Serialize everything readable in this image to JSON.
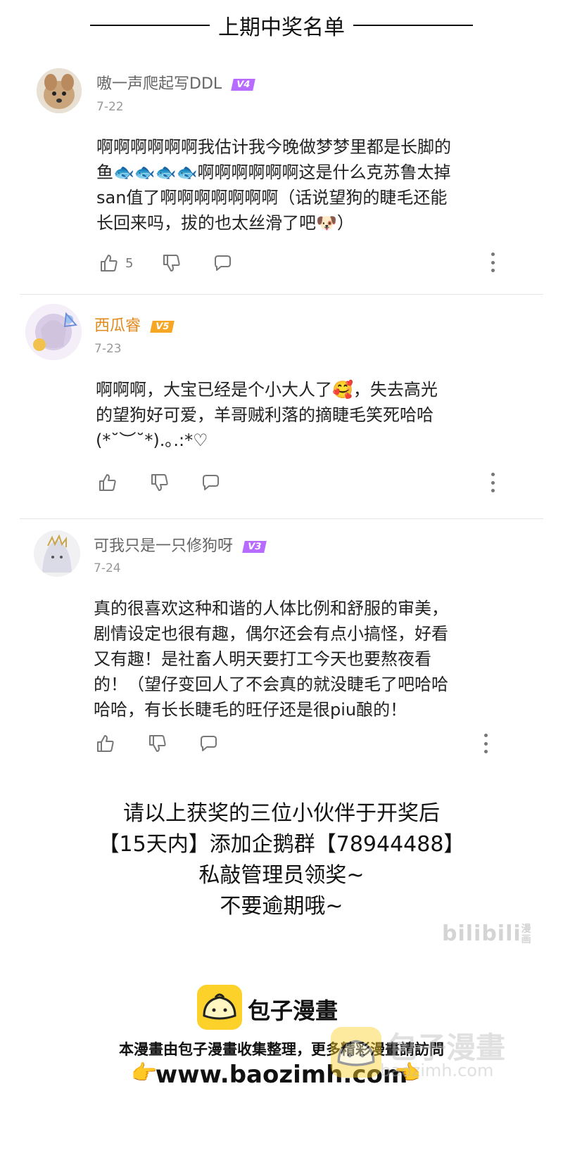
{
  "header": {
    "title": "上期中奖名单"
  },
  "comments": [
    {
      "username": "嗷一声爬起写DDL",
      "level": "V4",
      "date": "7-22",
      "text": "啊啊啊啊啊啊我估计我今晚做梦梦里都是长脚的\n鱼🐟🐟🐟🐟啊啊啊啊啊啊这是什么克苏鲁太掉\nsan值了啊啊啊啊啊啊啊（话说望狗的睫毛还能\n长回来吗，拔的也太丝滑了吧🐶）",
      "likes": "5"
    },
    {
      "username": "西瓜睿",
      "level": "V5",
      "date": "7-23",
      "text": "啊啊啊，大宝已经是个小大人了🥰，失去高光\n的望狗好可爱，羊哥贼利落的摘睫毛笑死哈哈\n(*˘︶˘*).｡.:*♡",
      "likes": ""
    },
    {
      "username": "可我只是一只修狗呀",
      "level": "V3",
      "date": "7-24",
      "text": "真的很喜欢这种和谐的人体比例和舒服的审美，\n剧情设定也很有趣，偶尔还会有点小搞怪，好看\n又有趣！是社畜人明天要打工今天也要熬夜看\n的！（望仔变回人了不会真的就没睫毛了吧哈哈\n哈哈，有长长睫毛的旺仔还是很piu酿的！",
      "likes": ""
    }
  ],
  "notice": {
    "line1": "请以上获奖的三位小伙伴于开奖后",
    "line2": "【15天内】添加企鹅群【78944488】",
    "line3": "私敲管理员领奖~",
    "line4": "不要逾期哦~"
  },
  "watermark": {
    "bili": "bilibili",
    "bili_tag": "漫画"
  },
  "footer": {
    "brand": "包子漫畫",
    "collect": "本漫畫由包子漫畫收集整理，更多精彩漫畫請訪問",
    "site": "www.baozimh.com",
    "wm_text": "包子漫畫",
    "wm_url": "baozimh.com"
  },
  "colors": {
    "v4": "#b76cff",
    "v5": "#f5a623",
    "v3": "#b76cff",
    "logo": "#fcd22a"
  }
}
